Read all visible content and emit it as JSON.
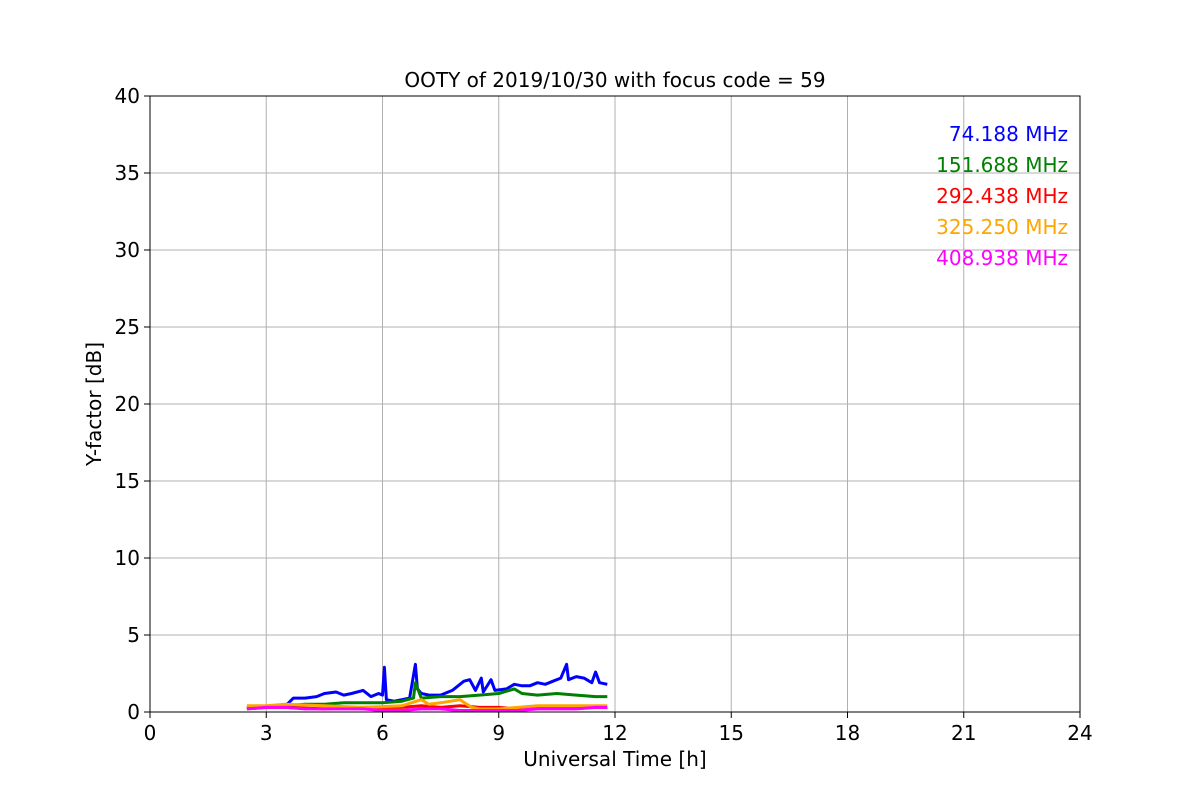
{
  "chart_data": {
    "type": "line",
    "title": "OOTY of 2019/10/30 with focus code = 59",
    "xlabel": "Universal Time [h]",
    "ylabel": "Y-factor [dB]",
    "xlim": [
      0,
      24
    ],
    "ylim": [
      0,
      40
    ],
    "xticks": [
      0,
      3,
      6,
      9,
      12,
      15,
      18,
      21,
      24
    ],
    "yticks": [
      0,
      5,
      10,
      15,
      20,
      25,
      30,
      35,
      40
    ],
    "grid": true,
    "legend_position": "top-right",
    "series": [
      {
        "name": "74.188 MHz",
        "color": "#0000ff",
        "x": [
          2.5,
          3.0,
          3.5,
          3.7,
          4.0,
          4.3,
          4.5,
          4.8,
          5.0,
          5.2,
          5.5,
          5.7,
          5.9,
          6.0,
          6.05,
          6.1,
          6.3,
          6.5,
          6.7,
          6.85,
          6.9,
          7.0,
          7.2,
          7.5,
          7.8,
          8.0,
          8.1,
          8.25,
          8.4,
          8.55,
          8.6,
          8.8,
          8.9,
          9.2,
          9.4,
          9.6,
          9.8,
          10.0,
          10.2,
          10.4,
          10.6,
          10.75,
          10.8,
          11.0,
          11.2,
          11.4,
          11.5,
          11.6,
          11.8
        ],
        "y": [
          0.3,
          0.3,
          0.4,
          0.9,
          0.9,
          1.0,
          1.2,
          1.3,
          1.1,
          1.2,
          1.4,
          1.0,
          1.2,
          1.1,
          2.9,
          0.8,
          0.7,
          0.8,
          0.9,
          3.1,
          1.5,
          1.2,
          1.1,
          1.1,
          1.4,
          1.8,
          2.0,
          2.1,
          1.4,
          2.2,
          1.3,
          2.1,
          1.4,
          1.5,
          1.8,
          1.7,
          1.7,
          1.9,
          1.8,
          2.0,
          2.2,
          3.1,
          2.1,
          2.3,
          2.2,
          1.9,
          2.6,
          1.9,
          1.8
        ]
      },
      {
        "name": "151.688 MHz",
        "color": "#008000",
        "x": [
          2.5,
          3.0,
          3.5,
          4.0,
          4.5,
          5.0,
          5.5,
          6.0,
          6.5,
          6.8,
          6.85,
          7.0,
          7.5,
          8.0,
          8.5,
          9.0,
          9.4,
          9.6,
          10.0,
          10.5,
          11.0,
          11.5,
          11.8
        ],
        "y": [
          0.2,
          0.3,
          0.4,
          0.5,
          0.5,
          0.6,
          0.6,
          0.6,
          0.7,
          0.9,
          1.9,
          0.9,
          1.0,
          1.0,
          1.1,
          1.2,
          1.5,
          1.2,
          1.1,
          1.2,
          1.1,
          1.0,
          1.0
        ]
      },
      {
        "name": "292.438 MHz",
        "color": "#ff0000",
        "x": [
          2.5,
          3.5,
          4.5,
          5.5,
          6.5,
          7.0,
          7.5,
          8.0,
          8.5,
          9.0,
          9.5,
          10.0,
          10.5,
          11.0,
          11.8
        ],
        "y": [
          0.3,
          0.3,
          0.2,
          0.3,
          0.3,
          0.4,
          0.3,
          0.4,
          0.3,
          0.3,
          0.2,
          0.3,
          0.3,
          0.3,
          0.3
        ]
      },
      {
        "name": "325.250 MHz",
        "color": "#ffa500",
        "x": [
          2.5,
          3.0,
          3.5,
          4.5,
          5.5,
          6.5,
          7.0,
          7.2,
          7.5,
          8.0,
          8.3,
          8.5,
          9.0,
          9.5,
          10.0,
          10.5,
          11.0,
          11.8
        ],
        "y": [
          0.4,
          0.4,
          0.5,
          0.4,
          0.3,
          0.4,
          0.8,
          0.5,
          0.6,
          0.8,
          0.3,
          0.2,
          0.2,
          0.3,
          0.4,
          0.4,
          0.4,
          0.4
        ]
      },
      {
        "name": "408.938 MHz",
        "color": "#ff00ff",
        "x": [
          2.5,
          3.0,
          3.5,
          4.0,
          4.5,
          5.0,
          5.5,
          6.0,
          6.5,
          7.0,
          7.5,
          8.0,
          8.5,
          9.0,
          9.5,
          10.0,
          10.5,
          11.0,
          11.5,
          11.8
        ],
        "y": [
          0.2,
          0.3,
          0.3,
          0.2,
          0.2,
          0.2,
          0.2,
          0.1,
          0.1,
          0.2,
          0.2,
          0.1,
          0.1,
          0.1,
          0.1,
          0.2,
          0.2,
          0.2,
          0.3,
          0.3
        ]
      }
    ]
  }
}
